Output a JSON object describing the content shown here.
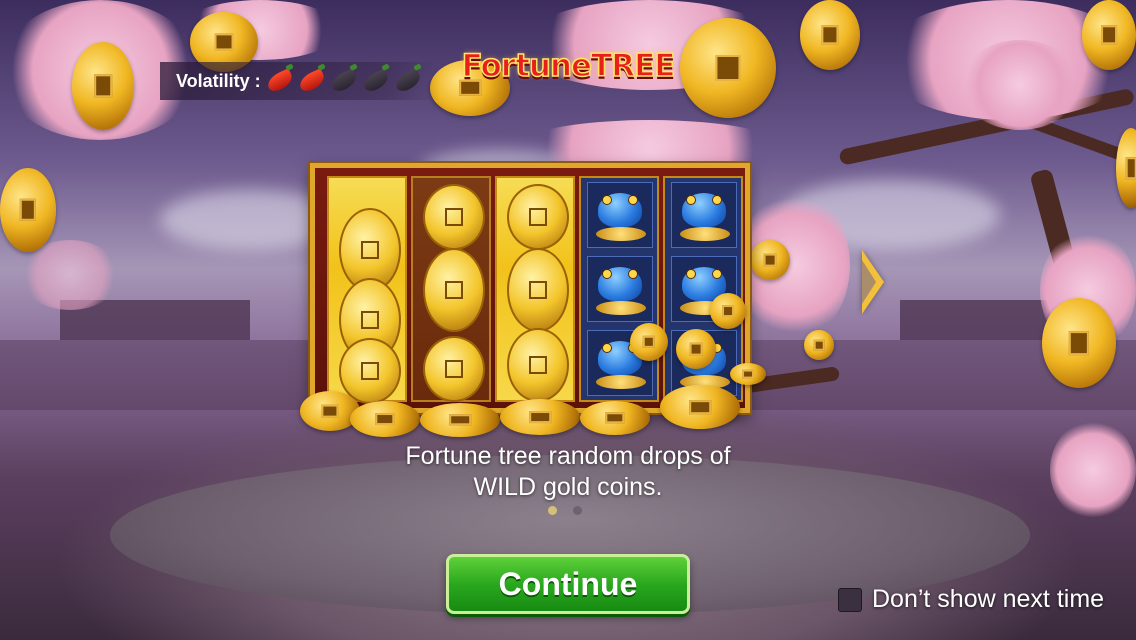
{
  "header": {
    "volatility_label": "Volatility :",
    "volatility_level": 2,
    "volatility_max": 5,
    "logo_text": "FortuneTREE"
  },
  "intro": {
    "description_line1": "Fortune tree random drops of",
    "description_line2": "WILD gold coins.",
    "page_current": 1,
    "page_total": 2
  },
  "actions": {
    "continue_label": "Continue",
    "dont_show_label": "Don’t show next time",
    "dont_show_checked": false
  },
  "icons": {
    "next": "chevron-right-icon",
    "volatility": "chili-pepper-icon"
  },
  "colors": {
    "continue_green": "#2aa81f",
    "logo_red": "#e8201c",
    "gold": "#f2c21a"
  }
}
